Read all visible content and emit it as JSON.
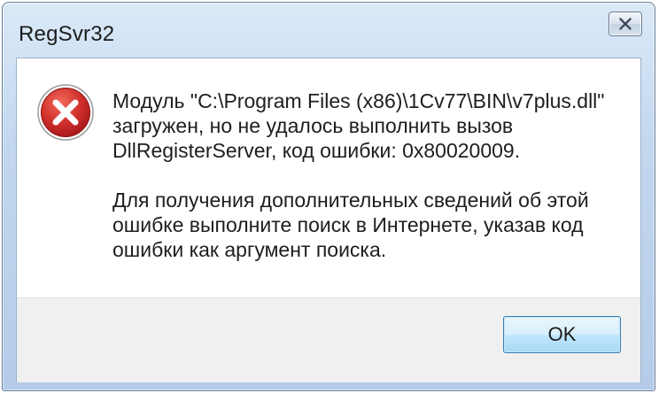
{
  "window": {
    "title": "RegSvr32"
  },
  "message": {
    "line1": "Модуль \"C:\\Program Files (x86)\\1Cv77\\BIN\\v7plus.dll\"",
    "line2": "загружен, но не удалось выполнить вызов",
    "line3": "DllRegisterServer, код ошибки: 0x80020009.",
    "line4": "Для получения дополнительных сведений об этой",
    "line5": "ошибке выполните поиск в Интернете, указав код",
    "line6": "ошибки как аргумент поиска."
  },
  "buttons": {
    "ok_label": "OK"
  },
  "icons": {
    "error": "error-icon",
    "close": "close-icon"
  },
  "colors": {
    "error_red": "#c8262b",
    "button_border": "#3c7fb1",
    "footer_bg": "#f0f0f0"
  }
}
